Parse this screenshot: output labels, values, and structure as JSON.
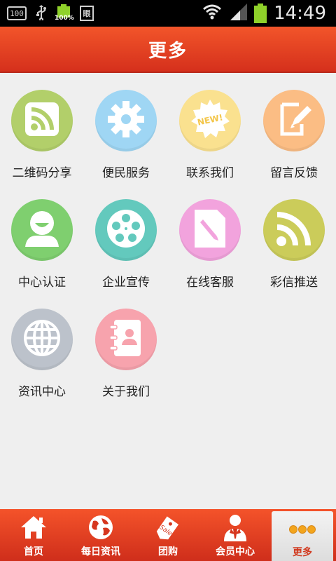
{
  "status_bar": {
    "left_icons": [
      "100-box-icon",
      "usb-icon",
      "battery-small-icon",
      "document-icon"
    ],
    "box_text": "100",
    "battery_small_text": "100%",
    "doc_text": "眼",
    "time": "14:49"
  },
  "header": {
    "title": "更多"
  },
  "menu": [
    {
      "label": "二维码分享",
      "icon": "rss-icon",
      "color": "#b2cf6a"
    },
    {
      "label": "便民服务",
      "icon": "gear-icon",
      "color": "#9fd6f4"
    },
    {
      "label": "联系我们",
      "icon": "new-badge-icon",
      "color": "#fae18f"
    },
    {
      "label": "留言反馈",
      "icon": "edit-icon",
      "color": "#fbbd84"
    },
    {
      "label": "中心认证",
      "icon": "user-icon",
      "color": "#7fcf6f"
    },
    {
      "label": "企业宣传",
      "icon": "film-reel-icon",
      "color": "#63c9bd"
    },
    {
      "label": "在线客服",
      "icon": "document-pencil-icon",
      "color": "#f2a3dd"
    },
    {
      "label": "彩信推送",
      "icon": "wifi-feed-icon",
      "color": "#cbcc5a"
    },
    {
      "label": "资讯中心",
      "icon": "globe-icon",
      "color": "#bcc2cb"
    },
    {
      "label": "关于我们",
      "icon": "contact-book-icon",
      "color": "#f7a3ad"
    }
  ],
  "navbar": {
    "items": [
      {
        "label": "首页",
        "icon": "home-icon"
      },
      {
        "label": "每日资讯",
        "icon": "globe-nav-icon"
      },
      {
        "label": "团购",
        "icon": "sale-tag-icon"
      },
      {
        "label": "会员中心",
        "icon": "member-icon"
      },
      {
        "label": "更多",
        "icon": "more-dots-icon",
        "active": true
      }
    ]
  }
}
